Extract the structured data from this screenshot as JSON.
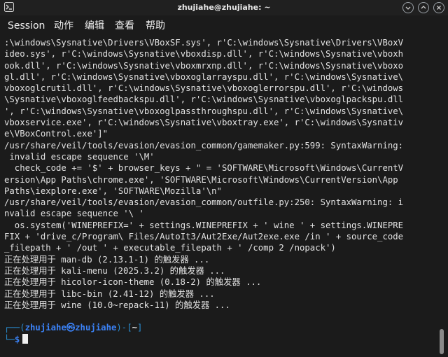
{
  "window": {
    "title": "zhujiahe@zhujiahe: ~",
    "colors": {
      "background": "#1b1b1b",
      "text": "#e2e2e2",
      "prompt_blue": "#3b82f6"
    },
    "controls": [
      "minimize-icon",
      "maximize-icon",
      "close-icon"
    ]
  },
  "menubar": {
    "session": "Session",
    "actions": "动作",
    "edit": "编辑",
    "view": "查看",
    "help": "帮助"
  },
  "terminal": {
    "lines": [
      ":\\windows\\Sysnative\\Drivers\\VBoxSF.sys', r'C:\\windows\\Sysnative\\Drivers\\VBoxV",
      "ideo.sys', r'C:\\windows\\Sysnative\\vboxdisp.dll', r'C:\\windows\\Sysnative\\vboxh",
      "ook.dll', r'C:\\windows\\Sysnative\\vboxmrxnp.dll', r'C:\\windows\\Sysnative\\vboxo",
      "gl.dll', r'C:\\windows\\Sysnative\\vboxoglarrayspu.dll', r'C:\\windows\\Sysnative\\",
      "vboxoglcrutil.dll', r'C:\\windows\\Sysnative\\vboxoglerrorspu.dll', r'C:\\windows",
      "\\Sysnative\\vboxoglfeedbackspu.dll', r'C:\\windows\\Sysnative\\vboxoglpackspu.dll",
      "', r'C:\\windows\\Sysnative\\vboxoglpassthroughspu.dll', r'C:\\windows\\Sysnative\\",
      "vboxservice.exe', r'C:\\windows\\Sysnative\\vboxtray.exe', r'C:\\windows\\Sysnativ",
      "e\\VBoxControl.exe']\"",
      "/usr/share/veil/tools/evasion/evasion_common/gamemaker.py:599: SyntaxWarning:",
      " invalid escape sequence '\\M'",
      "  check_code += '$' + browser_keys + \" = 'SOFTWARE\\Microsoft\\Windows\\CurrentV",
      "ersion\\App Paths\\chrome.exe', 'SOFTWARE\\Microsoft\\Windows\\CurrentVersion\\App",
      "Paths\\iexplore.exe', 'SOFTWARE\\Mozilla'\\n\"",
      "/usr/share/veil/tools/evasion/evasion_common/outfile.py:250: SyntaxWarning: i",
      "nvalid escape sequence '\\ '",
      "  os.system('WINEPREFIX=' + settings.WINEPREFIX + ' wine ' + settings.WINEPRE",
      "FIX + 'drive_c/Program\\ Files/AutoIt3/Aut2Exe/Aut2exe.exe /in ' + source_code",
      "_filepath + ' /out ' + executable_filepath + ' /comp 2 /nopack')",
      "正在处理用于 man-db (2.13.1-1) 的触发器 ...",
      "正在处理用于 kali-menu (2025.3.2) 的触发器 ...",
      "正在处理用于 hicolor-icon-theme (0.18-2) 的触发器 ...",
      "正在处理用于 libc-bin (2.41-12) 的触发器 ...",
      "正在处理用于 wine (10.0~repack-11) 的触发器 ..."
    ],
    "prompt": {
      "line1_start": "┌──(",
      "user_host": "zhujiahe㉿zhujiahe",
      "line1_mid": ")-[",
      "dir": "~",
      "line1_end": "]",
      "line2_start": "└─",
      "dollar": "$"
    }
  }
}
